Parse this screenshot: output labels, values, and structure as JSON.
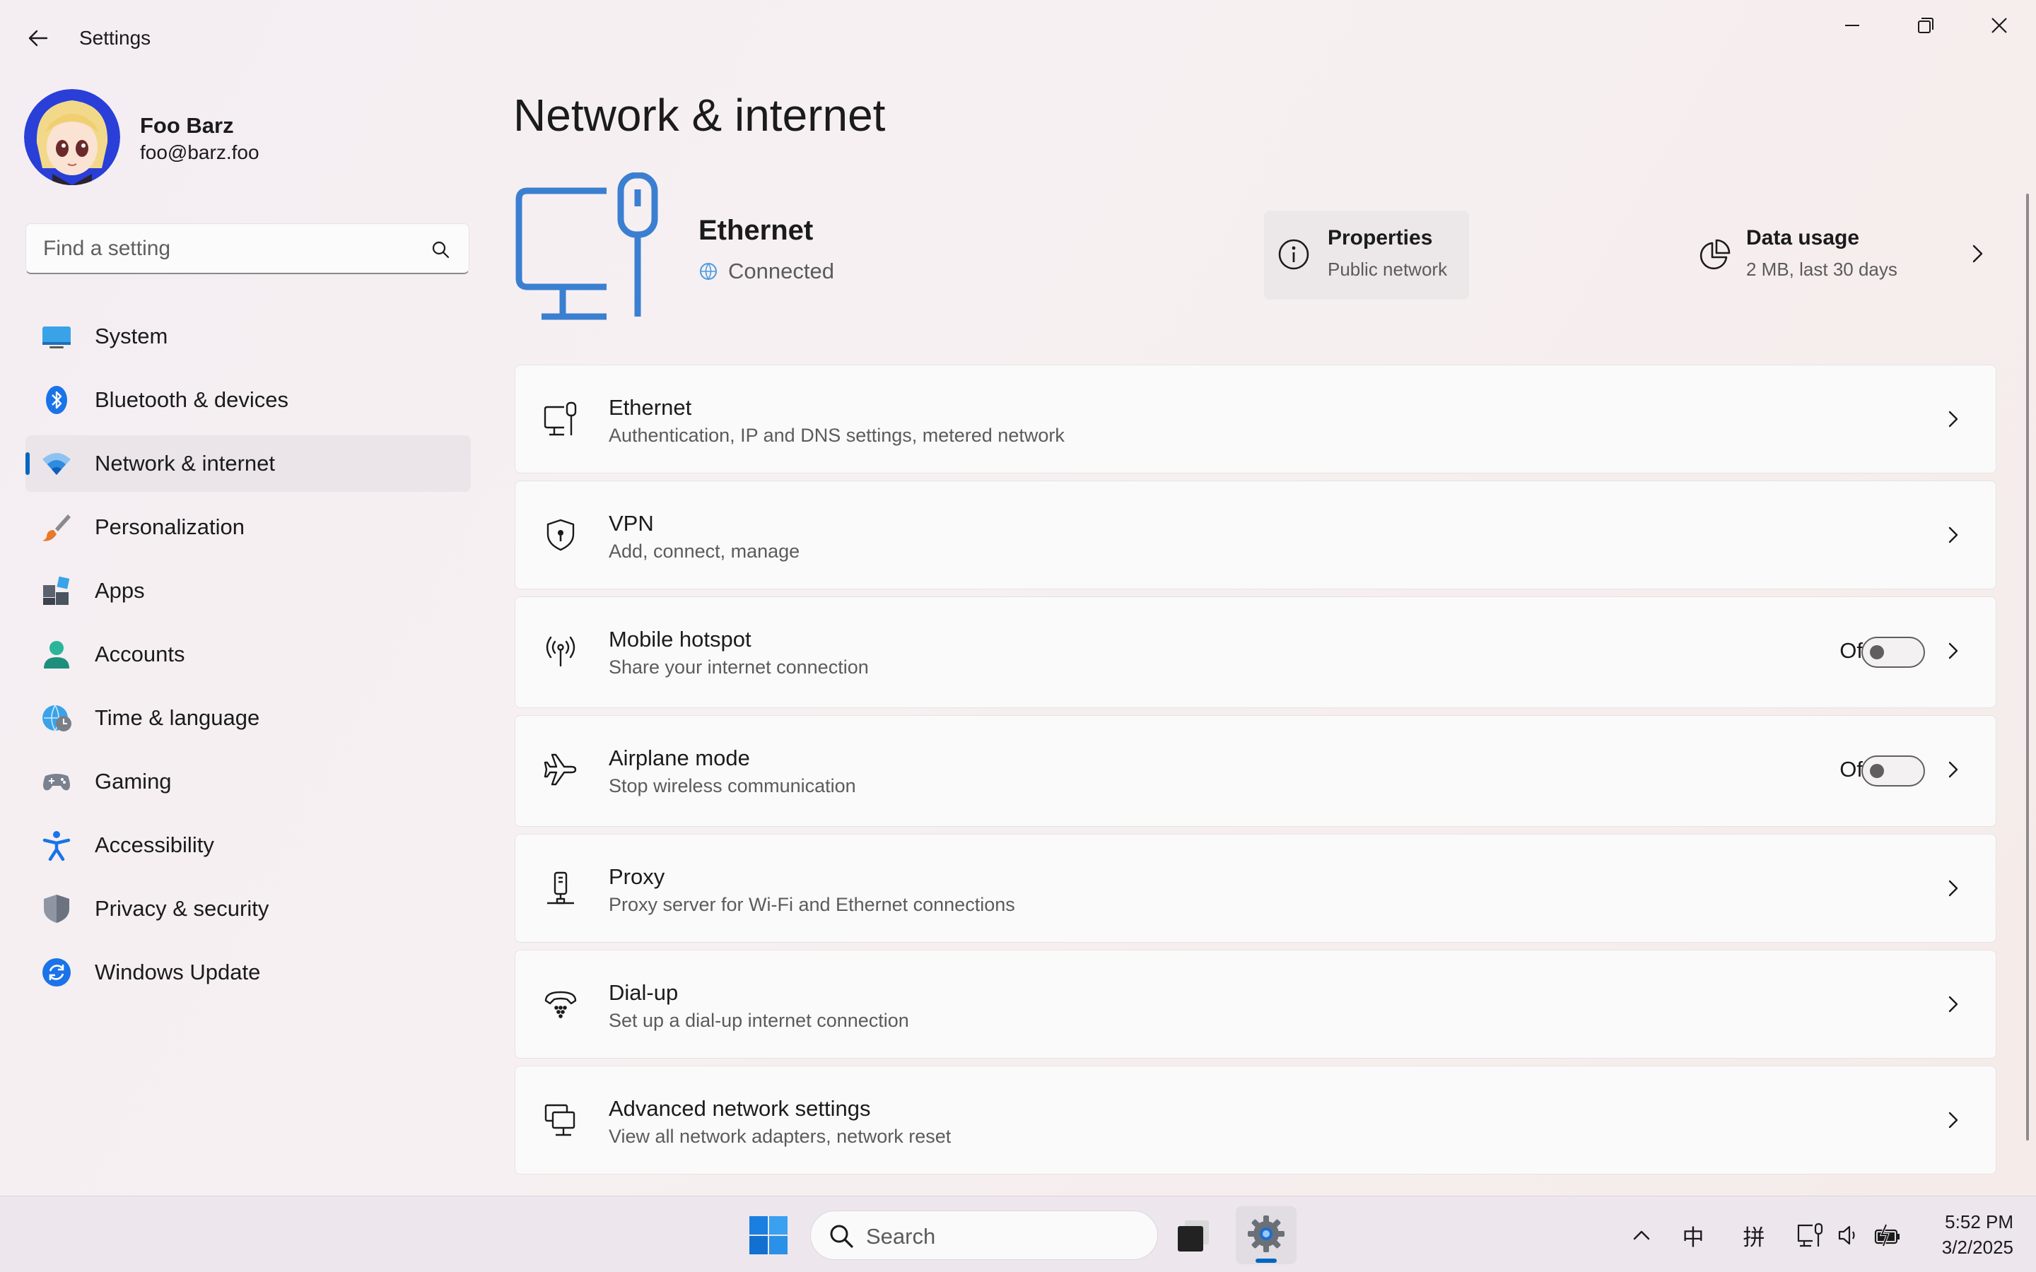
{
  "window": {
    "title": "Settings"
  },
  "user": {
    "name": "Foo Barz",
    "email": "foo@barz.foo"
  },
  "search": {
    "placeholder": "Find a setting"
  },
  "sidebar": {
    "items": [
      {
        "label": "System",
        "icon": "system-icon"
      },
      {
        "label": "Bluetooth & devices",
        "icon": "bluetooth-icon"
      },
      {
        "label": "Network & internet",
        "icon": "wifi-icon",
        "active": true
      },
      {
        "label": "Personalization",
        "icon": "brush-icon"
      },
      {
        "label": "Apps",
        "icon": "apps-icon"
      },
      {
        "label": "Accounts",
        "icon": "person-icon"
      },
      {
        "label": "Time & language",
        "icon": "globe-clock-icon"
      },
      {
        "label": "Gaming",
        "icon": "gamepad-icon"
      },
      {
        "label": "Accessibility",
        "icon": "accessibility-icon"
      },
      {
        "label": "Privacy & security",
        "icon": "shield-icon"
      },
      {
        "label": "Windows Update",
        "icon": "update-icon"
      }
    ]
  },
  "main": {
    "title": "Network & internet",
    "hero": {
      "name": "Ethernet",
      "status": "Connected"
    },
    "properties": {
      "title": "Properties",
      "subtitle": "Public network"
    },
    "data_usage": {
      "title": "Data usage",
      "subtitle": "2 MB, last 30 days"
    },
    "items": [
      {
        "title": "Ethernet",
        "subtitle": "Authentication, IP and DNS settings, metered network",
        "icon": "ethernet-icon"
      },
      {
        "title": "VPN",
        "subtitle": "Add, connect, manage",
        "icon": "vpn-shield-icon"
      },
      {
        "title": "Mobile hotspot",
        "subtitle": "Share your internet connection",
        "icon": "hotspot-icon",
        "toggle": "Off",
        "toggle_on": false
      },
      {
        "title": "Airplane mode",
        "subtitle": "Stop wireless communication",
        "icon": "airplane-icon",
        "toggle": "Off",
        "toggle_on": false
      },
      {
        "title": "Proxy",
        "subtitle": "Proxy server for Wi-Fi and Ethernet connections",
        "icon": "proxy-icon"
      },
      {
        "title": "Dial-up",
        "subtitle": "Set up a dial-up internet connection",
        "icon": "dialup-icon"
      },
      {
        "title": "Advanced network settings",
        "subtitle": "View all network adapters, network reset",
        "icon": "advanced-network-icon"
      }
    ]
  },
  "taskbar": {
    "search_label": "Search",
    "ime_lang": "中",
    "ime_mode": "拼",
    "time": "5:52 PM",
    "date": "3/2/2025"
  },
  "colors": {
    "accent": "#0067c0",
    "hero_icon": "#3b7fd1"
  }
}
